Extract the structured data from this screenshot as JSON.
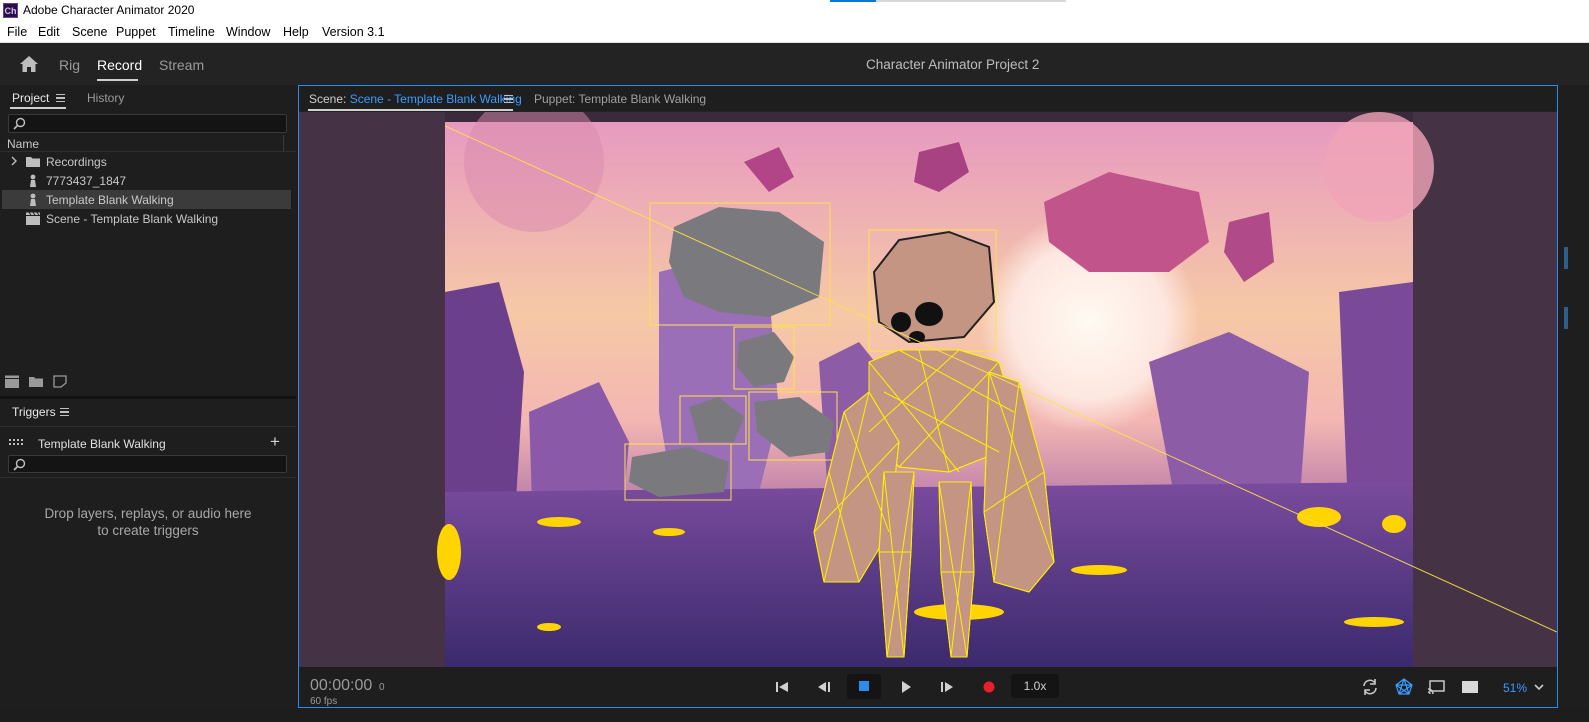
{
  "window": {
    "title": "Adobe Character Animator 2020",
    "logo_text": "Ch"
  },
  "menu": [
    "File",
    "Edit",
    "Scene",
    "Puppet",
    "Timeline",
    "Window",
    "Help",
    "Version 3.1"
  ],
  "workspace": {
    "tabs": [
      {
        "label": "Rig",
        "active": false
      },
      {
        "label": "Record",
        "active": true
      },
      {
        "label": "Stream",
        "active": false
      }
    ],
    "project_name": "Character Animator Project 2"
  },
  "project_panel": {
    "tabs": [
      {
        "label": "Project",
        "active": true
      },
      {
        "label": "History",
        "active": false
      }
    ],
    "search_placeholder": "",
    "column_name": "Name",
    "items": [
      {
        "label": "Recordings",
        "icon": "folder-icon",
        "expandable": true,
        "selected": false
      },
      {
        "label": "7773437_1847",
        "icon": "puppet-icon",
        "expandable": false,
        "selected": false
      },
      {
        "label": "Template Blank Walking",
        "icon": "puppet-icon",
        "expandable": false,
        "selected": true
      },
      {
        "label": "Scene - Template Blank Walking",
        "icon": "scene-icon",
        "expandable": false,
        "selected": false
      }
    ]
  },
  "triggers_panel": {
    "title": "Triggers",
    "puppet_name": "Template Blank Walking",
    "add_symbol": "+",
    "search_placeholder": "",
    "empty_line1": "Drop layers, replays, or audio here",
    "empty_line2": "to create triggers"
  },
  "scene_panel": {
    "scene_tab_prefix": "Scene: ",
    "scene_tab_name": "Scene - Template Blank Walking",
    "puppet_tab": "Puppet: Template Blank Walking",
    "accent_color": "#3b9bff"
  },
  "transport": {
    "timecode": "00:00:00",
    "frame": "0",
    "fps": "60 fps",
    "speed": "1.0x",
    "zoom": "51%"
  }
}
